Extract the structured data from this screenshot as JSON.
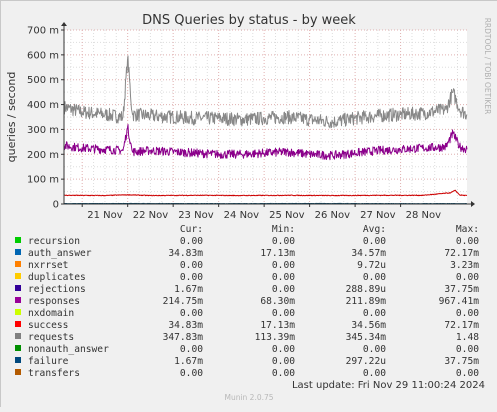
{
  "chart_data": {
    "type": "line",
    "title": "DNS Queries by status - by week",
    "ylabel": "queries / second",
    "watermark": "RRDTOOL / TOBI OETIKER",
    "ylim": [
      0,
      700
    ],
    "y_ticks": [
      {
        "value": 0,
        "label": "0"
      },
      {
        "value": 100,
        "label": "100 m"
      },
      {
        "value": 200,
        "label": "200 m"
      },
      {
        "value": 300,
        "label": "300 m"
      },
      {
        "value": 400,
        "label": "400 m"
      },
      {
        "value": 500,
        "label": "500 m"
      },
      {
        "value": 600,
        "label": "600 m"
      },
      {
        "value": 700,
        "label": "700 m"
      }
    ],
    "x_ticks": [
      "21 Nov",
      "22 Nov",
      "23 Nov",
      "24 Nov",
      "25 Nov",
      "26 Nov",
      "27 Nov",
      "28 Nov"
    ],
    "x_range_days": [
      20.6,
      29.46
    ],
    "colors": {
      "background": "#f0f0f0",
      "plot_bg": "#ffffff",
      "grid_major": "#e0b0b0",
      "grid_minor": "#dddddd",
      "axis": "#333333"
    },
    "series": [
      {
        "name": "requests",
        "color": "#888888",
        "x": [
          20.6,
          21.0,
          21.5,
          21.9,
          22.0,
          22.1,
          22.5,
          23.0,
          23.5,
          24.0,
          24.5,
          25.0,
          25.5,
          26.0,
          26.5,
          27.0,
          27.5,
          28.0,
          28.5,
          29.0,
          29.15,
          29.3,
          29.46
        ],
        "values": [
          390,
          370,
          360,
          350,
          590,
          360,
          355,
          350,
          345,
          345,
          340,
          345,
          350,
          340,
          330,
          345,
          355,
          360,
          365,
          380,
          450,
          380,
          360
        ]
      },
      {
        "name": "responses",
        "color": "#8b008b",
        "x": [
          20.6,
          21.0,
          21.5,
          21.9,
          22.0,
          22.1,
          22.5,
          23.0,
          23.5,
          24.0,
          24.5,
          25.0,
          25.5,
          26.0,
          26.5,
          27.0,
          27.5,
          28.0,
          28.5,
          29.0,
          29.15,
          29.3,
          29.46
        ],
        "values": [
          235,
          225,
          220,
          215,
          310,
          210,
          215,
          210,
          205,
          200,
          200,
          205,
          210,
          200,
          195,
          205,
          215,
          220,
          225,
          230,
          285,
          230,
          220
        ]
      },
      {
        "name": "success",
        "color": "#cc0000",
        "x": [
          20.6,
          21.5,
          22.0,
          22.5,
          23.5,
          24.5,
          25.5,
          26.5,
          27.5,
          28.5,
          29.1,
          29.2,
          29.3,
          29.46
        ],
        "values": [
          35,
          34,
          37,
          34,
          35,
          34,
          35,
          34,
          35,
          35,
          45,
          55,
          36,
          34
        ]
      },
      {
        "name": "failure",
        "color": "#004466",
        "x": [
          20.6,
          22.0,
          24.0,
          26.0,
          28.0,
          29.46
        ],
        "values": [
          1.5,
          2,
          1.5,
          2,
          1.5,
          1.6
        ]
      }
    ],
    "legend": {
      "headers": [
        "Cur:",
        "Min:",
        "Avg:",
        "Max:"
      ],
      "rows": [
        {
          "name": "recursion",
          "color": "#00cc00",
          "cur": "0.00",
          "min": "0.00",
          "avg": "0.00",
          "max": "0.00"
        },
        {
          "name": "auth_answer",
          "color": "#0066b3",
          "cur": "34.83m",
          "min": "17.13m",
          "avg": "34.57m",
          "max": "72.17m"
        },
        {
          "name": "nxrrset",
          "color": "#ff8000",
          "cur": "0.00",
          "min": "0.00",
          "avg": "9.72u",
          "max": "3.23m"
        },
        {
          "name": "duplicates",
          "color": "#ffcc00",
          "cur": "0.00",
          "min": "0.00",
          "avg": "0.00",
          "max": "0.00"
        },
        {
          "name": "rejections",
          "color": "#330099",
          "cur": "1.67m",
          "min": "0.00",
          "avg": "288.89u",
          "max": "37.75m"
        },
        {
          "name": "responses",
          "color": "#990099",
          "cur": "214.75m",
          "min": "68.30m",
          "avg": "211.89m",
          "max": "967.41m"
        },
        {
          "name": "nxdomain",
          "color": "#ccff00",
          "cur": "0.00",
          "min": "0.00",
          "avg": "0.00",
          "max": "0.00"
        },
        {
          "name": "success",
          "color": "#ff0000",
          "cur": "34.83m",
          "min": "17.13m",
          "avg": "34.56m",
          "max": "72.17m"
        },
        {
          "name": "requests",
          "color": "#808080",
          "cur": "347.83m",
          "min": "113.39m",
          "avg": "345.34m",
          "max": "1.48"
        },
        {
          "name": "nonauth_answer",
          "color": "#008f00",
          "cur": "0.00",
          "min": "0.00",
          "avg": "0.00",
          "max": "0.00"
        },
        {
          "name": "failure",
          "color": "#00487d",
          "cur": "1.67m",
          "min": "0.00",
          "avg": "297.22u",
          "max": "37.75m"
        },
        {
          "name": "transfers",
          "color": "#b35a00",
          "cur": "0.00",
          "min": "0.00",
          "avg": "0.00",
          "max": "0.00"
        }
      ]
    },
    "last_update": "Last update: Fri Nov 29 11:00:24 2024",
    "footer": "Munin 2.0.75"
  }
}
